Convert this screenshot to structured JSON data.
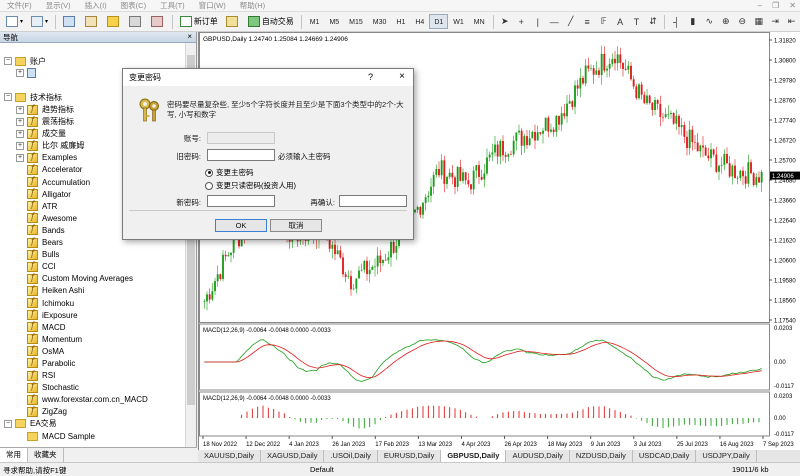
{
  "menubar": {
    "items": [
      "文件(F)",
      "显示(V)",
      "插入(I)",
      "图表(C)",
      "工具(T)",
      "窗口(W)",
      "帮助(H)"
    ]
  },
  "toolbar": {
    "new_order": "新订单",
    "auto_trade": "自动交易",
    "timeframes": [
      "M1",
      "M5",
      "M15",
      "M30",
      "H1",
      "H4",
      "D1",
      "W1",
      "MN"
    ],
    "active_timeframe": "D1"
  },
  "navigator": {
    "title": "导航",
    "close": "×",
    "accounts_label": "账户",
    "indicators_label": "技术指标",
    "folders": [
      "趋势指标",
      "震荡指标",
      "成交量",
      "比尔 威廉姆",
      "Examples"
    ],
    "indicators": [
      "Accelerator",
      "Accumulation",
      "Alligator",
      "ATR",
      "Awesome",
      "Bands",
      "Bears",
      "Bulls",
      "CCI",
      "Custom Moving Averages",
      "Heiken Ashi",
      "Ichimoku",
      "iExposure",
      "MACD",
      "Momentum",
      "OsMA",
      "Parabolic",
      "RSI",
      "Stochastic",
      "www.forexstar.com.cn_MACD",
      "ZigZag"
    ],
    "ea_label": "EA交易",
    "ea_items": [
      "MACD Sample"
    ],
    "tabs": [
      "常用",
      "收藏夹"
    ],
    "active_tab": "常用"
  },
  "chart": {
    "header": "GBPUSD,Daily  1.24740 1.25084 1.24669 1.24906",
    "current_price": "1.24906",
    "price_ticks": [
      "1.31820",
      "1.30800",
      "1.29780",
      "1.28760",
      "1.27740",
      "1.26720",
      "1.25700",
      "1.24680",
      "1.23660",
      "1.22640",
      "1.21620",
      "1.20600",
      "1.19580",
      "1.18560",
      "1.17540"
    ],
    "macd1_label": "MACD(12,26,9) -0.0064 -0.0048 0.0000 -0.0033",
    "macd1_ticks": [
      "0.0203",
      "0.00",
      "-0.0117"
    ],
    "macd2_label": "MACD(12,26,9) -0.0064 -0.0048 0.0000 -0.0033",
    "macd2_ticks": [
      "0.0203",
      "0.00",
      "-0.0117"
    ],
    "date_ticks": [
      "18 Nov 2022",
      "12 Dec 2022",
      "4 Jan 2023",
      "26 Jan 2023",
      "17 Feb 2023",
      "13 Mar 2023",
      "4 Apr 2023",
      "26 Apr 2023",
      "18 May 2023",
      "9 Jun 2023",
      "3 Jul 2023",
      "25 Jul 2023",
      "16 Aug 2023",
      "7 Sep 2023"
    ],
    "colors": {
      "bull": "#1a9e1a",
      "bear": "#e01b1b",
      "signal": "#e01b1b",
      "main": "#1a9e1a"
    }
  },
  "symbol_tabs": {
    "items": [
      "XAUUSD,Daily",
      "XAGUSD,Daily",
      ".USOil,Daily",
      "EURUSD,Daily",
      "GBPUSD,Daily",
      "AUDUSD,Daily",
      "NZDUSD,Daily",
      "USDCAD,Daily",
      "USDJPY,Daily"
    ],
    "active": "GBPUSD,Daily"
  },
  "statusbar": {
    "help": "寻求帮助,请按F1键",
    "profile": "Default",
    "traffic": "19011/6 kb"
  },
  "dialog": {
    "title": "变更密码",
    "help": "?",
    "close": "×",
    "message": "密码要尽量复杂些, 至少5个字符长度并且至少是下面3个类型中的2个-大写, 小写和数字",
    "account_label": "账号:",
    "old_password_label": "旧密码:",
    "old_password_value": "",
    "must_enter_hint": "必须输入主密码",
    "radio_master": "变更主密码",
    "radio_readonly": "变更只读密码(投资人用)",
    "new_password_label": "新密码:",
    "confirm_label": "再确认:",
    "ok": "OK",
    "cancel": "取消"
  }
}
